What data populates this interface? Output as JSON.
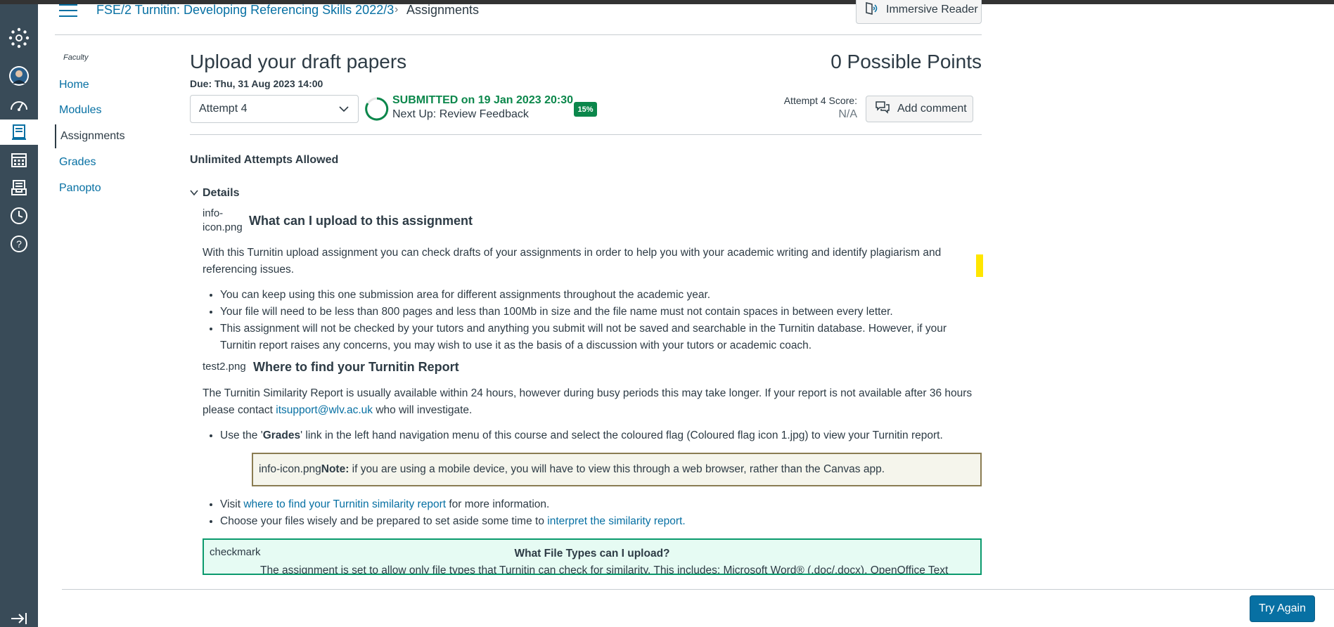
{
  "course": {
    "breadcrumb_course": "FSE/2 Turnitin: Developing Referencing Skills 2022/3",
    "breadcrumb_separator": "›",
    "breadcrumb_current": "Assignments",
    "immersive_reader_label": "Immersive Reader"
  },
  "course_nav": {
    "subaccount": "Faculty",
    "items": [
      {
        "label": "Home"
      },
      {
        "label": "Modules"
      },
      {
        "label": "Assignments"
      },
      {
        "label": "Grades"
      },
      {
        "label": "Panopto"
      }
    ]
  },
  "assignment": {
    "title": "Upload your draft papers",
    "points": "0 Possible Points",
    "due": "Due: Thu, 31 Aug 2023 14:00",
    "attempt_selected": "Attempt 4",
    "submitted_status": "SUBMITTED on 19 Jan 2023 20:30",
    "next_up": "Next Up: Review Feedback",
    "similarity_badge": "15%",
    "score_label": "Attempt 4 Score:",
    "score_value": "N/A",
    "add_comment_label": "Add comment",
    "unlimited_attempts": "Unlimited Attempts Allowed",
    "details_label": "Details"
  },
  "details": {
    "section1_img_alt": "info-icon.png",
    "section1_title": "What can I upload to this assignment",
    "section1_intro": "With this Turnitin upload assignment you can check drafts of your assignments in order to help you with your academic writing and identify plagiarism and referencing issues.",
    "section1_bullets": [
      "You can keep using this one submission area for different assignments throughout the academic year.",
      "Your file will need to be less than 800 pages and less than 100Mb in size and the file name must not contain spaces in between every letter.",
      "This assignment will not be checked by your tutors and anything you submit will not be saved and searchable in the Turnitin database. However, if your Turnitin report raises any concerns, you may wish to use it as the basis of a discussion with your tutors or academic coach."
    ],
    "section2_img_alt": "test2.png",
    "section2_title": "Where to find your Turnitin Report",
    "section2_intro_before": "The Turnitin Similarity Report is usually available within 24 hours, however during busy periods this may take longer. If your report is not available after 36 hours please contact ",
    "section2_email": "itsupport@wlv.ac.uk",
    "section2_intro_after": " who will investigate.",
    "grades_bullet_before": "Use the '",
    "grades_bullet_bold": "Grades",
    "grades_bullet_middle": "' link in the left hand navigation menu of this course and select the coloured flag (",
    "grades_bullet_img_alt": "Coloured flag icon 1.jpg",
    "grades_bullet_after": ") to view your Turnitin report.",
    "note_img_alt": "info-icon.png",
    "note_bold": "Note:",
    "note_text": " if you are using a mobile device, you will have to view this through a web browser, rather than the Canvas app.",
    "visit_before": " Visit ",
    "visit_link": "where to find your Turnitin similarity report",
    "visit_after": " for more information.",
    "choose_before": "Choose your files wisely and be prepared to set aside some time to ",
    "choose_link": "interpret the similarity report. ",
    "filetypes_img_alt": "checkmark",
    "filetypes_title": "What File Types can I upload?",
    "filetypes_text": "The assignment is set to allow only file types that Turnitin can check for similarity. This includes: Microsoft Word® (.doc/.docx), OpenOffice Text"
  },
  "footer": {
    "try_again_label": "Try Again"
  },
  "colors": {
    "link": "#0770a3",
    "success": "#0b874b",
    "nav_bg": "#394b58"
  }
}
